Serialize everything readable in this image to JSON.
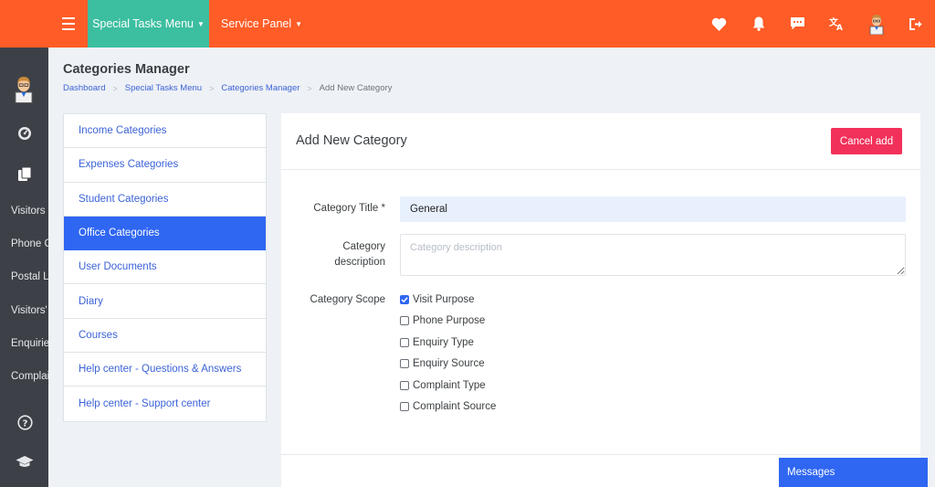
{
  "topbar": {
    "special_tasks_menu": "Special Tasks Menu",
    "service_panel": "Service Panel",
    "accent_color": "#ff5c27",
    "active_color": "#3cbea0",
    "icons": [
      "heart-icon",
      "bell-icon",
      "chat-icon",
      "translate-icon",
      "user-avatar",
      "logout-icon"
    ]
  },
  "sidebar": {
    "background": "#3d4147",
    "items": [
      {
        "label": "Visitors"
      },
      {
        "label": "Phone C"
      },
      {
        "label": "Postal L"
      },
      {
        "label": "Visitors'"
      },
      {
        "label": "Enquirie"
      },
      {
        "label": "Complai"
      }
    ]
  },
  "page": {
    "title": "Categories Manager",
    "breadcrumb": [
      "Dashboard",
      "Special Tasks Menu",
      "Categories Manager",
      "Add New Category"
    ]
  },
  "categories": {
    "items": [
      {
        "label": "Income Categories",
        "active": false
      },
      {
        "label": "Expenses Categories",
        "active": false
      },
      {
        "label": "Student Categories",
        "active": false
      },
      {
        "label": "Office Categories",
        "active": true
      },
      {
        "label": "User Documents",
        "active": false
      },
      {
        "label": "Diary",
        "active": false
      },
      {
        "label": "Courses",
        "active": false
      },
      {
        "label": "Help center - Questions & Answers",
        "active": false
      },
      {
        "label": "Help center - Support center",
        "active": false
      }
    ]
  },
  "form": {
    "card_title": "Add New Category",
    "cancel_label": "Cancel add",
    "title_label": "Category Title *",
    "title_value": "General",
    "desc_label_1": "Category",
    "desc_label_2": "description",
    "desc_placeholder": "Category description",
    "scope_label": "Category Scope",
    "scope_options": [
      {
        "label": "Visit Purpose",
        "checked": true
      },
      {
        "label": "Phone Purpose",
        "checked": false
      },
      {
        "label": "Enquiry Type",
        "checked": false
      },
      {
        "label": "Enquiry Source",
        "checked": false
      },
      {
        "label": "Complaint Type",
        "checked": false
      },
      {
        "label": "Complaint Source",
        "checked": false
      }
    ]
  },
  "messages": {
    "label": "Messages"
  }
}
